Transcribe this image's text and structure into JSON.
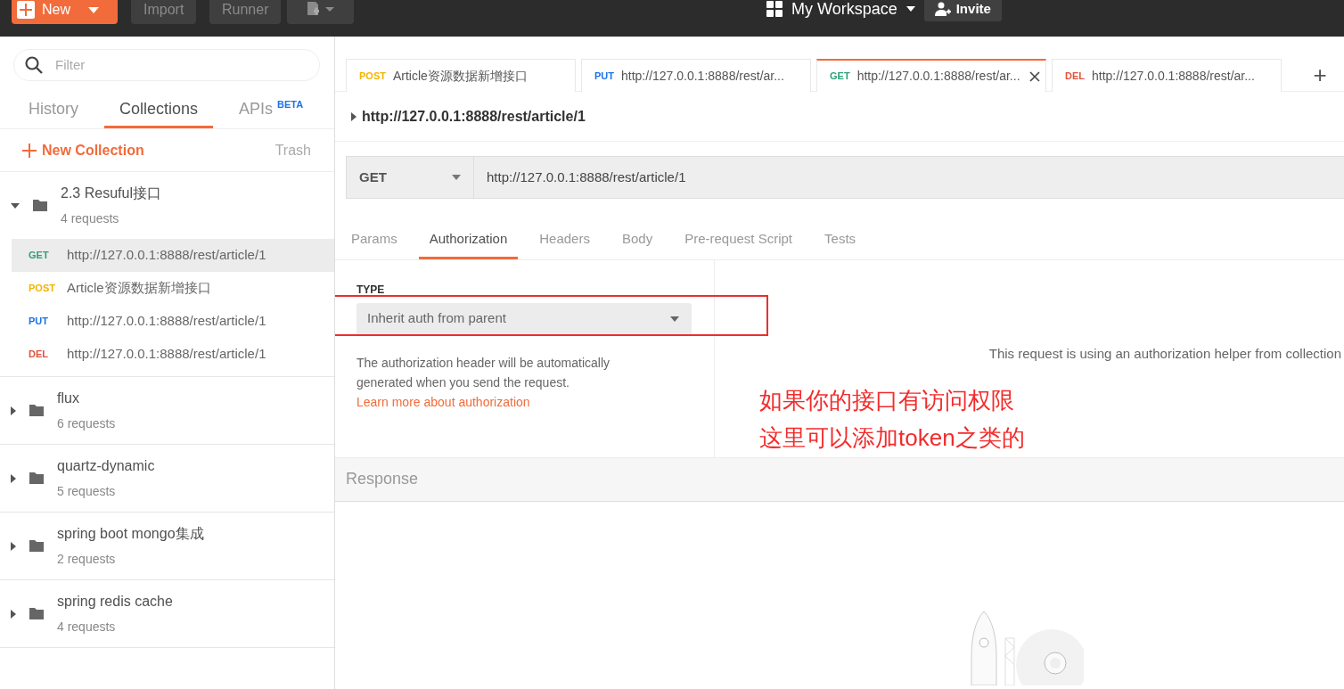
{
  "header": {
    "new_button": "New",
    "buttons": [
      "Import",
      "Runner"
    ],
    "workspace": "My Workspace",
    "invite": "Invite"
  },
  "sidebar": {
    "filter": {
      "placeholder": "Filter"
    },
    "tabs": [
      {
        "label": "History",
        "selected": false
      },
      {
        "label": "Collections",
        "selected": true
      },
      {
        "label": "APIs",
        "selected": false,
        "badge": "BETA"
      }
    ],
    "new_collection": "New Collection",
    "trash": "Trash",
    "collections": [
      {
        "name": "2.3 Resuful接口",
        "count": "4 requests",
        "expanded": true,
        "requests": [
          {
            "method": "GET",
            "color": "#2e9e78",
            "name": "http://127.0.0.1:8888/rest/article/1",
            "selected": true
          },
          {
            "method": "POST",
            "color": "#f4b400",
            "name": "Article资源数据新增接口",
            "selected": false
          },
          {
            "method": "PUT",
            "color": "#1a73e8",
            "name": "http://127.0.0.1:8888/rest/article/1",
            "selected": false
          },
          {
            "method": "DEL",
            "color": "#e0533a",
            "name": "http://127.0.0.1:8888/rest/article/1",
            "selected": false
          }
        ]
      },
      {
        "name": "flux",
        "count": "6 requests",
        "expanded": false
      },
      {
        "name": "quartz-dynamic",
        "count": "5 requests",
        "expanded": false
      },
      {
        "name": "spring boot mongo集成",
        "count": "2 requests",
        "expanded": false
      },
      {
        "name": "spring redis cache",
        "count": "4 requests",
        "expanded": false
      }
    ]
  },
  "main": {
    "tabs": [
      {
        "method": "POST",
        "color": "#f4b400",
        "title": "Article资源数据新增接口",
        "selected": false
      },
      {
        "method": "PUT",
        "color": "#1a73e8",
        "title": "http://127.0.0.1:8888/rest/ar...",
        "selected": false
      },
      {
        "method": "GET",
        "color": "#2e9e78",
        "title": "http://127.0.0.1:8888/rest/ar...",
        "selected": true
      },
      {
        "method": "DEL",
        "color": "#e0533a",
        "title": "http://127.0.0.1:8888/rest/ar...",
        "selected": false
      }
    ],
    "add_tab": "+",
    "request_title": "http://127.0.0.1:8888/rest/article/1",
    "method": "GET",
    "url": "http://127.0.0.1:8888/rest/article/1",
    "request_tabs": [
      {
        "label": "Params",
        "selected": false
      },
      {
        "label": "Authorization",
        "selected": true
      },
      {
        "label": "Headers",
        "selected": false
      },
      {
        "label": "Body",
        "selected": false
      },
      {
        "label": "Pre-request Script",
        "selected": false
      },
      {
        "label": "Tests",
        "selected": false
      }
    ],
    "auth": {
      "type_label": "TYPE",
      "type_value": "Inherit auth from parent",
      "description": "The authorization header will be automatically generated when you send the request.",
      "link": "Learn more about authorization",
      "helper": "This request is using an authorization helper from collection"
    },
    "annotation": {
      "lines": [
        "如果你的接口有访问权限",
        "这里可以添加token之类的"
      ]
    },
    "response": "Response"
  }
}
